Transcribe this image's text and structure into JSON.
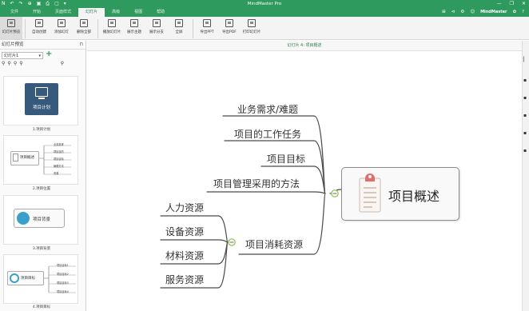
{
  "app": {
    "title": "MindMaster Pro",
    "quick_access": [
      "N",
      "↶",
      "↷",
      "⊕",
      "▣",
      "⎙",
      "▢",
      "▾"
    ]
  },
  "menu": {
    "tabs": [
      "文件",
      "开始",
      "页面样式",
      "幻灯片",
      "高级",
      "视图",
      "帮助"
    ],
    "right_icons": [
      "⊞",
      "⊲",
      "⚙",
      "☺"
    ],
    "brand": "MindMaster",
    "settings": "✿",
    "help": "?"
  },
  "ribbon": {
    "buttons": [
      "幻灯片预览",
      "自动创建",
      "添加幻灯",
      "删除全部",
      "播放幻灯片",
      "展示主题",
      "展示分支",
      "全屏",
      "导出PPT",
      "导出PDF",
      "打印幻灯片"
    ]
  },
  "left_panel": {
    "title": "幻灯片预览",
    "pin": "⊓",
    "select_value": "幻灯片1",
    "add": "+",
    "tool_icons": [
      "⚲",
      "⚲",
      "⚲",
      "⚲",
      "⚲"
    ],
    "slides": [
      {
        "caption": "1.项目计划",
        "label": "项目计划"
      },
      {
        "caption": "2.项目位置",
        "label": "项目概述",
        "items": [
          "业务需求",
          "项目目的",
          "项目目标",
          "管理方法",
          "资源"
        ]
      },
      {
        "caption": "3.项目背景",
        "label": "项目背景"
      },
      {
        "caption": "4.项目目标",
        "label": "项目目标",
        "items": [
          "项目目标1",
          "项目目标2",
          "项目目标3",
          "项目目标4"
        ]
      }
    ]
  },
  "canvas": {
    "tab_label": "幻灯片 4: 项目概述",
    "central": "项目概述",
    "branches": [
      "业务需求/难题",
      "项目的工作任务",
      "项目目标",
      "项目管理采用的方法",
      "项目消耗资源"
    ],
    "sub_branches": [
      "人力资源",
      "设备资源",
      "材料资源",
      "服务资源"
    ]
  },
  "right_bar": {
    "icons": [
      "▏",
      "▪",
      "▪",
      "▪",
      "▪",
      "▪"
    ]
  },
  "colors": {
    "accent": "#2e9a5e",
    "branch_line": "#4a4a4a",
    "collapse_ring": "#8bc34a"
  }
}
